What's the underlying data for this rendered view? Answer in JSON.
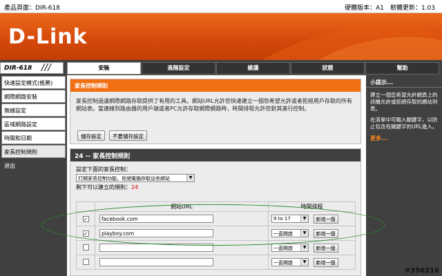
{
  "topbar": {
    "product": "產品頁面：DIR-618",
    "version": "硬體版本：A1　韌體更新：1.03"
  },
  "brand": {
    "logo": "D-Link"
  },
  "model": "DIR-618",
  "tabs": [
    {
      "label": "安裝",
      "active": true
    },
    {
      "label": "進階設定",
      "active": false
    },
    {
      "label": "維護",
      "active": false
    },
    {
      "label": "狀態",
      "active": false
    },
    {
      "label": "幫助",
      "active": false
    }
  ],
  "sidebar": [
    {
      "label": "快速設定模式(推薦)"
    },
    {
      "label": "網際網路安裝"
    },
    {
      "label": "無線設定"
    },
    {
      "label": "區域網路設定"
    },
    {
      "label": "時間和日期"
    },
    {
      "label": "家長控制規則",
      "active": true
    },
    {
      "label": "退出"
    }
  ],
  "parental": {
    "header": "家長控制規則",
    "description": "家長控制過濾網際網路存取提供了有用的工具。網站URL允許您快速建立一個您希望允許或者拒絕用戶存取的所有網站表。當連線到路由器的用戶端或者PC允許存取網際網路時，時間排程允許您對其進行控制。",
    "save_label": "儲存設定",
    "nosave_label": "不要儲存設定"
  },
  "rules": {
    "header": "24 -- 家長控制規則",
    "intro": "設定下面的家長控制：",
    "mode_selected": "打開家長控制功能，拒絕電腦存取這些網站",
    "remaining_label": "剩下可以建立的規則：",
    "remaining_count": "24",
    "col_url": "網站URL",
    "col_schedule": "時間排程",
    "rows": [
      {
        "checked": "✓",
        "url": "facebook.com",
        "schedule": "9 to 17",
        "add": "新增一個"
      },
      {
        "checked": "✓",
        "url": "playboy.com",
        "schedule": "一直開啟",
        "add": "新增一個"
      },
      {
        "checked": "",
        "url": "",
        "schedule": "一直開啟",
        "add": "新增一個"
      },
      {
        "checked": "",
        "url": "",
        "schedule": "一直開啟",
        "add": "新增一個"
      }
    ]
  },
  "hints": {
    "title": "小提示...",
    "p1": "建立一個您希望允許網頁上的訊機允許或拒絕存取的網站列表。",
    "p2": "在清單中可輸入關鍵字，以防止包含有關鍵字的URL進入。",
    "more": "更多..."
  },
  "watermark": "#356216",
  "colors": {
    "accent": "#f26f12",
    "dark": "#404040",
    "highlight": "#2b8a2b"
  }
}
